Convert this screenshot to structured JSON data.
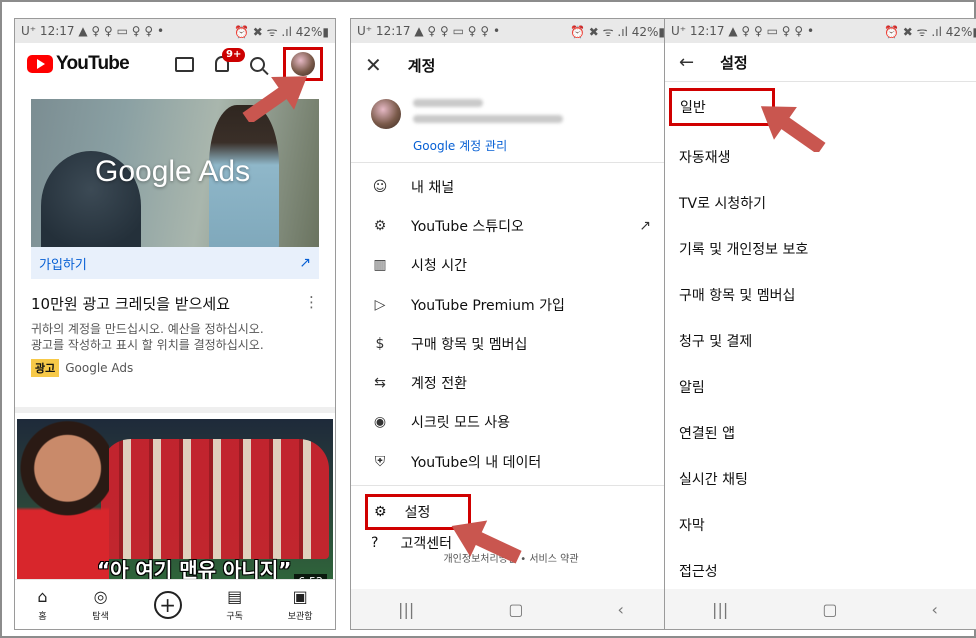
{
  "status_bar": {
    "left": "U⁺ 12:17 ▲ ♀ ♀ ▭ ♀ ♀ •",
    "right": "⏰ ✖ ᯤ .ıl 42%▮"
  },
  "phone1": {
    "logo_text": "YouTube",
    "notification_badge": "9+",
    "ad": {
      "brand_overlay": "Google Ads",
      "join_label": "가입하기",
      "title": "10만원 광고 크레딧을 받으세요",
      "desc_line1": "귀하의 계정을 만드십시오. 예산을 정하십시오.",
      "desc_line2": "광고를 작성하고 표시 할 위치를 결정하십시오.",
      "label": "광고",
      "advertiser": "Google Ads"
    },
    "video": {
      "caption": "“아 여기 맨유 아니지”",
      "duration": "6:52"
    },
    "tabs": [
      {
        "icon": "home-icon",
        "label": "홈"
      },
      {
        "icon": "compass-icon",
        "label": "탐색"
      },
      {
        "icon": "add-icon",
        "label": ""
      },
      {
        "icon": "subscriptions-icon",
        "label": "구독"
      },
      {
        "icon": "library-icon",
        "label": "보관함"
      }
    ]
  },
  "phone2": {
    "title": "계정",
    "manage_link": "Google 계정 관리",
    "menu": [
      {
        "icon": "person-icon",
        "label": "내 채널"
      },
      {
        "icon": "studio-gear-icon",
        "label": "YouTube 스튜디오"
      },
      {
        "icon": "bar-chart-icon",
        "label": "시청 시간"
      },
      {
        "icon": "play-icon",
        "label": "YouTube Premium 가입"
      },
      {
        "icon": "dollar-icon",
        "label": "구매 항목 및 멤버십"
      },
      {
        "icon": "switch-account-icon",
        "label": "계정 전환"
      },
      {
        "icon": "incognito-icon",
        "label": "시크릿 모드 사용"
      },
      {
        "icon": "shield-icon",
        "label": "YouTube의 내 데이터"
      }
    ],
    "settings": "설정",
    "help_partial": "고객센터",
    "footer_privacy": "개인정보처리방침",
    "footer_terms": "서비스 약관"
  },
  "phone3": {
    "title": "설정",
    "items": [
      "일반",
      "자동재생",
      "TV로 시청하기",
      "기록 및 개인정보 보호",
      "구매 항목 및 멤버십",
      "청구 및 결제",
      "알림",
      "연결된 앱",
      "실시간 채팅",
      "자막",
      "접근성"
    ]
  },
  "colors": {
    "highlight": "#d00000",
    "arrow": "#c9564f",
    "link": "#065fd4",
    "brand_red": "#ff0000"
  }
}
